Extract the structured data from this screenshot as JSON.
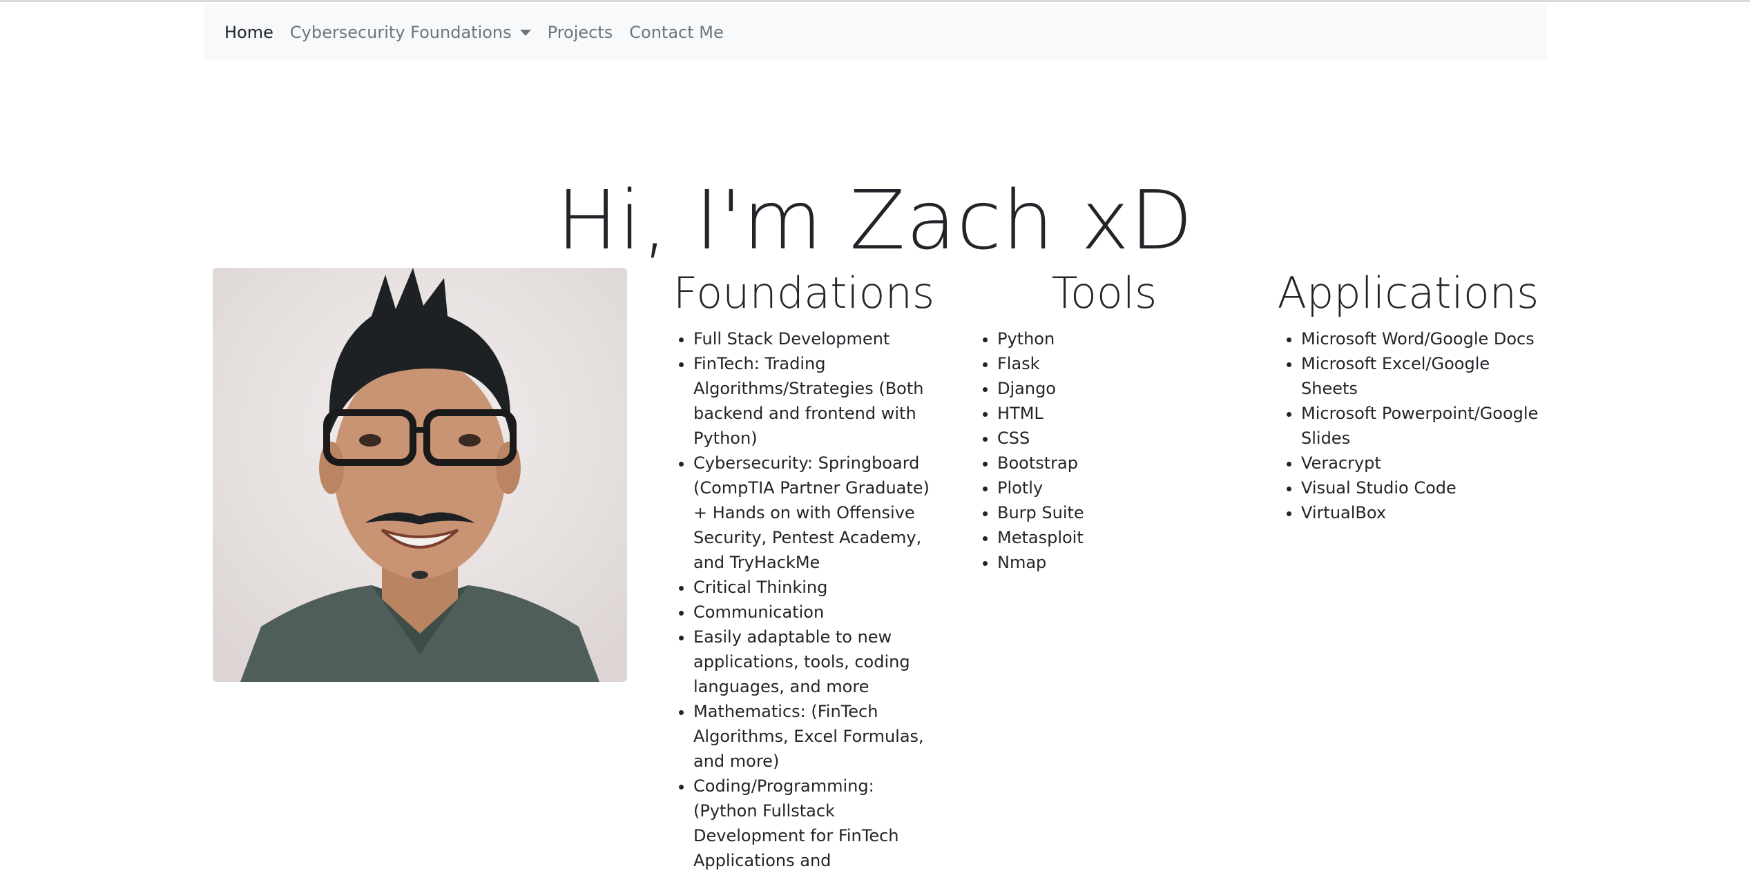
{
  "nav": {
    "items": [
      {
        "label": "Home",
        "active": true
      },
      {
        "label": "Cybersecurity Foundations",
        "dropdown": true
      },
      {
        "label": "Projects"
      },
      {
        "label": "Contact Me"
      }
    ]
  },
  "hero": {
    "title": "Hi, I'm Zach xD"
  },
  "sections": {
    "foundations": {
      "heading": "Foundations",
      "items": [
        "Full Stack Development",
        "FinTech: Trading Algorithms/Strategies (Both backend and frontend with Python)",
        "Cybersecurity: Springboard (CompTIA Partner Graduate) + Hands on with Offensive Security, Pentest Academy, and TryHackMe",
        "Critical Thinking",
        "Communication",
        "Easily adaptable to new applications, tools, coding languages, and more",
        "Mathematics: (FinTech Algorithms, Excel Formulas, and more)",
        "Coding/Programming: (Python Fullstack Development for FinTech Applications and"
      ]
    },
    "tools": {
      "heading": "Tools",
      "items": [
        "Python",
        "Flask",
        "Django",
        "HTML",
        "CSS",
        "Bootstrap",
        "Plotly",
        "Burp Suite",
        "Metasploit",
        "Nmap"
      ]
    },
    "applications": {
      "heading": "Applications",
      "items": [
        "Microsoft Word/Google Docs",
        "Microsoft Excel/Google Sheets",
        "Microsoft Powerpoint/Google Slides",
        "Veracrypt",
        "Visual Studio Code",
        "VirtualBox"
      ]
    }
  }
}
